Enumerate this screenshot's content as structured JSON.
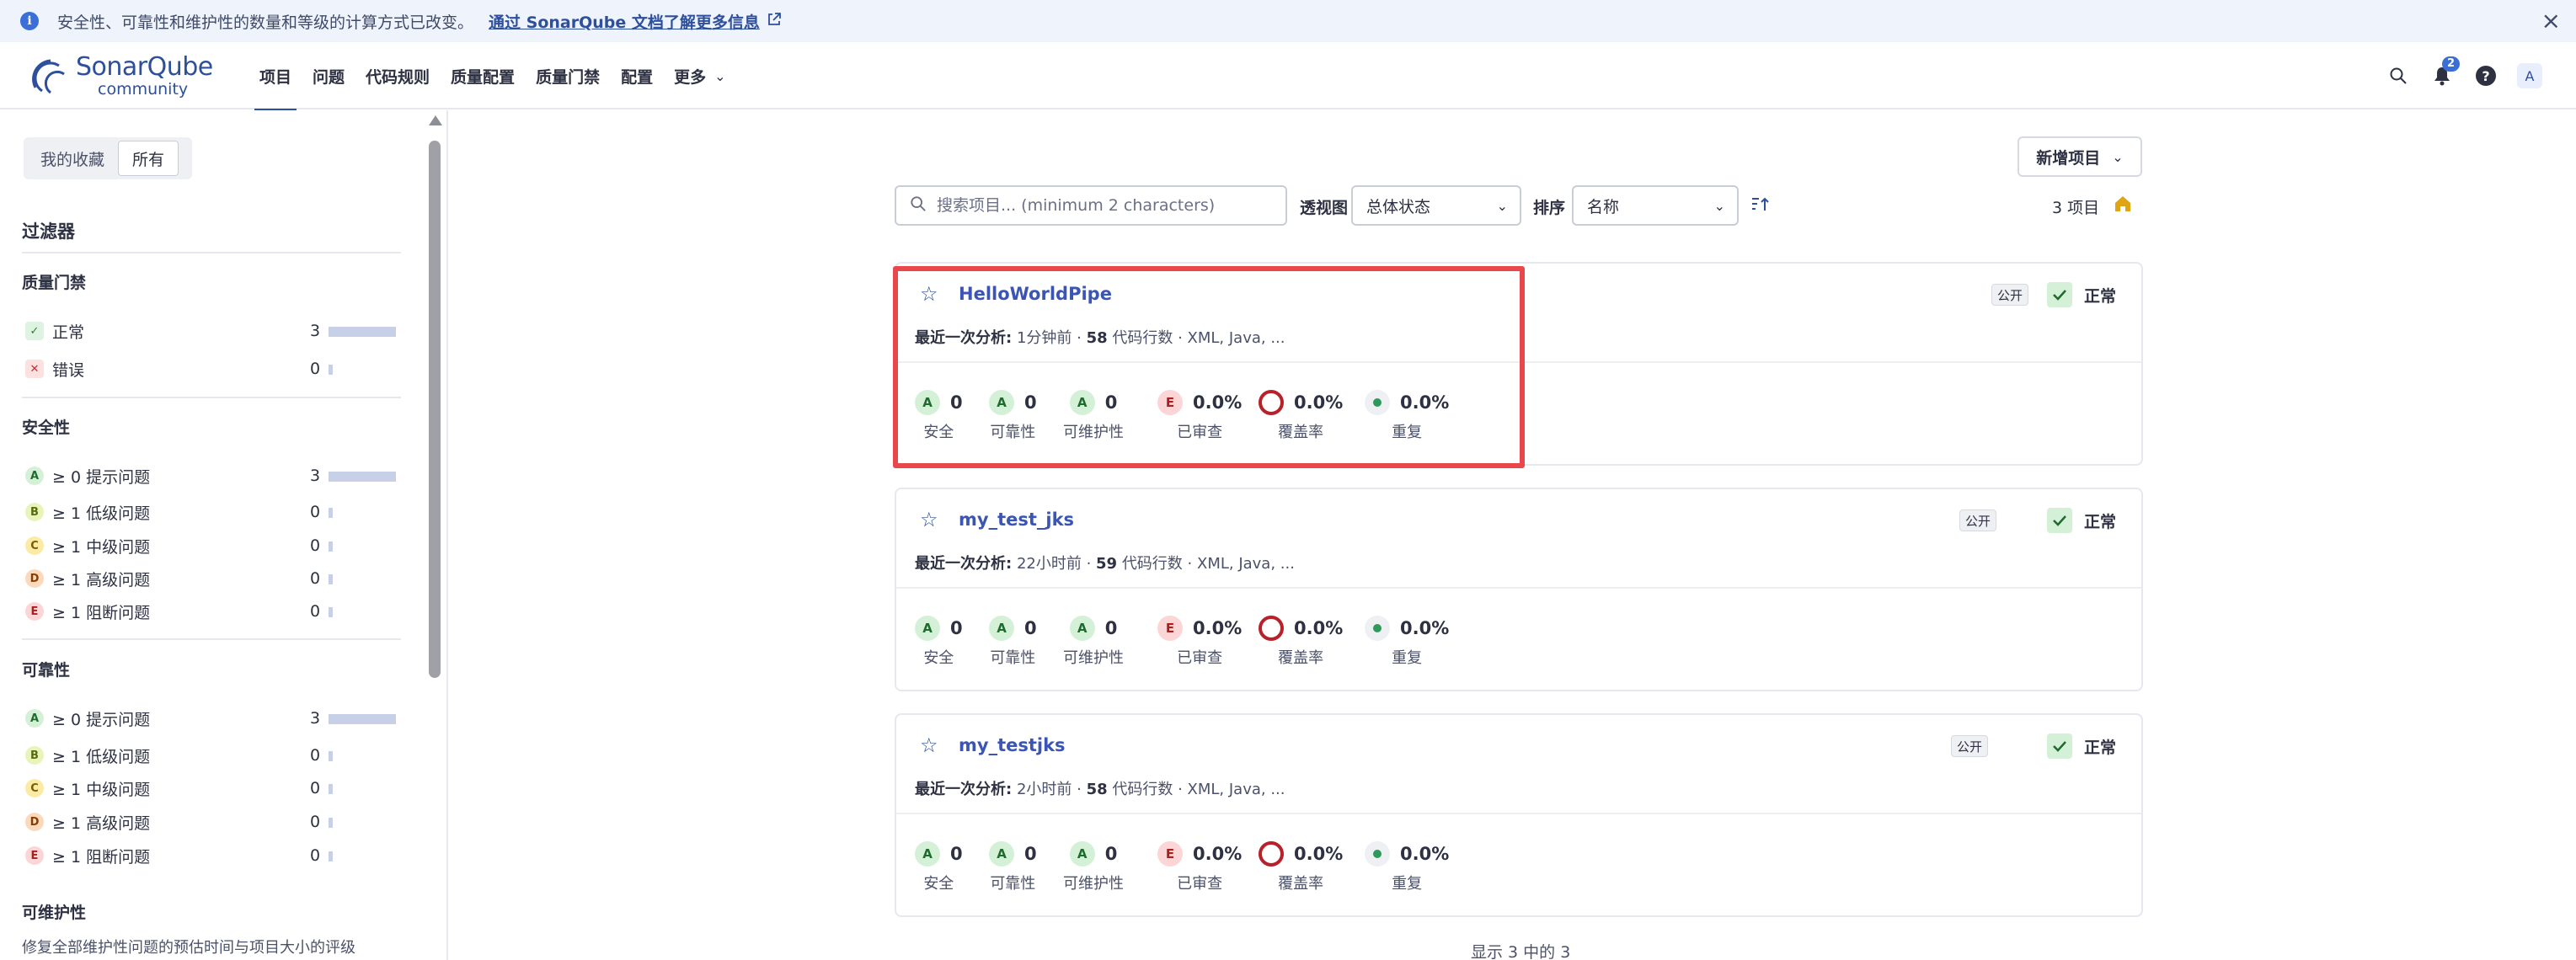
{
  "banner": {
    "text": "安全性、可靠性和维护性的数量和等级的计算方式已改变。",
    "link": "通过 SonarQube 文档了解更多信息"
  },
  "logo": {
    "name": "SonarQube",
    "sub": "community"
  },
  "nav": {
    "items": [
      {
        "label": "项目",
        "active": true
      },
      {
        "label": "问题"
      },
      {
        "label": "代码规则"
      },
      {
        "label": "质量配置"
      },
      {
        "label": "质量门禁"
      },
      {
        "label": "配置"
      },
      {
        "label": "更多"
      }
    ],
    "notifications": "2",
    "avatar": "A"
  },
  "sidebar": {
    "toggle": [
      "我的收藏",
      "所有"
    ],
    "filters_title": "过滤器",
    "quality_gate": {
      "title": "质量门禁",
      "rows": [
        {
          "icon": "✓",
          "label": "正常",
          "count": "3"
        },
        {
          "icon": "✕",
          "label": "错误",
          "count": "0"
        }
      ]
    },
    "security": {
      "title": "安全性",
      "rows": [
        {
          "grade": "A",
          "label": "≥ 0 提示问题",
          "count": "3"
        },
        {
          "grade": "B",
          "label": "≥ 1 低级问题",
          "count": "0"
        },
        {
          "grade": "C",
          "label": "≥ 1 中级问题",
          "count": "0"
        },
        {
          "grade": "D",
          "label": "≥ 1 高级问题",
          "count": "0"
        },
        {
          "grade": "E",
          "label": "≥ 1 阻断问题",
          "count": "0"
        }
      ]
    },
    "reliability": {
      "title": "可靠性",
      "rows": [
        {
          "grade": "A",
          "label": "≥ 0 提示问题",
          "count": "3"
        },
        {
          "grade": "B",
          "label": "≥ 1 低级问题",
          "count": "0"
        },
        {
          "grade": "C",
          "label": "≥ 1 中级问题",
          "count": "0"
        },
        {
          "grade": "D",
          "label": "≥ 1 高级问题",
          "count": "0"
        },
        {
          "grade": "E",
          "label": "≥ 1 阻断问题",
          "count": "0"
        }
      ]
    },
    "maintainability": {
      "title": "可维护性",
      "desc": "修复全部维护性问题的预估时间与项目大小的评级"
    }
  },
  "toolbar": {
    "new_project": "新增项目",
    "search_placeholder": "搜索项目... (minimum 2 characters)",
    "perspective_label": "透视图",
    "perspective_value": "总体状态",
    "sort_label": "排序",
    "sort_value": "名称",
    "count": "3 项目"
  },
  "metric_labels": [
    "安全",
    "可靠性",
    "可维护性",
    "已审查",
    "覆盖率",
    "重复"
  ],
  "projects": [
    {
      "name": "HelloWorldPipe",
      "visibility": "公开",
      "analysis_label": "最近一次分析:",
      "analysis_time": "1分钟前",
      "loc": "58",
      "loc_label": "代码行数",
      "langs": "XML, Java, ...",
      "status": "正常",
      "security": {
        "grade": "A",
        "value": "0"
      },
      "reliability": {
        "grade": "A",
        "value": "0"
      },
      "maintainability": {
        "grade": "A",
        "value": "0"
      },
      "reviewed": {
        "grade": "E",
        "value": "0.0%"
      },
      "coverage": "0.0%",
      "duplication": "0.0%"
    },
    {
      "name": "my_test_jks",
      "visibility": "公开",
      "analysis_label": "最近一次分析:",
      "analysis_time": "22小时前",
      "loc": "59",
      "loc_label": "代码行数",
      "langs": "XML, Java, ...",
      "status": "正常",
      "security": {
        "grade": "A",
        "value": "0"
      },
      "reliability": {
        "grade": "A",
        "value": "0"
      },
      "maintainability": {
        "grade": "A",
        "value": "0"
      },
      "reviewed": {
        "grade": "E",
        "value": "0.0%"
      },
      "coverage": "0.0%",
      "duplication": "0.0%"
    },
    {
      "name": "my_testjks",
      "visibility": "公开",
      "analysis_label": "最近一次分析:",
      "analysis_time": "2小时前",
      "loc": "58",
      "loc_label": "代码行数",
      "langs": "XML, Java, ...",
      "status": "正常",
      "security": {
        "grade": "A",
        "value": "0"
      },
      "reliability": {
        "grade": "A",
        "value": "0"
      },
      "maintainability": {
        "grade": "A",
        "value": "0"
      },
      "reviewed": {
        "grade": "E",
        "value": "0.0%"
      },
      "coverage": "0.0%",
      "duplication": "0.0%"
    }
  ],
  "footer": "显示 3 中的 3",
  "colors": {
    "accent": "#2d4f9c",
    "highlight": "#e8474c",
    "coverage_ring": "#b8202a"
  }
}
